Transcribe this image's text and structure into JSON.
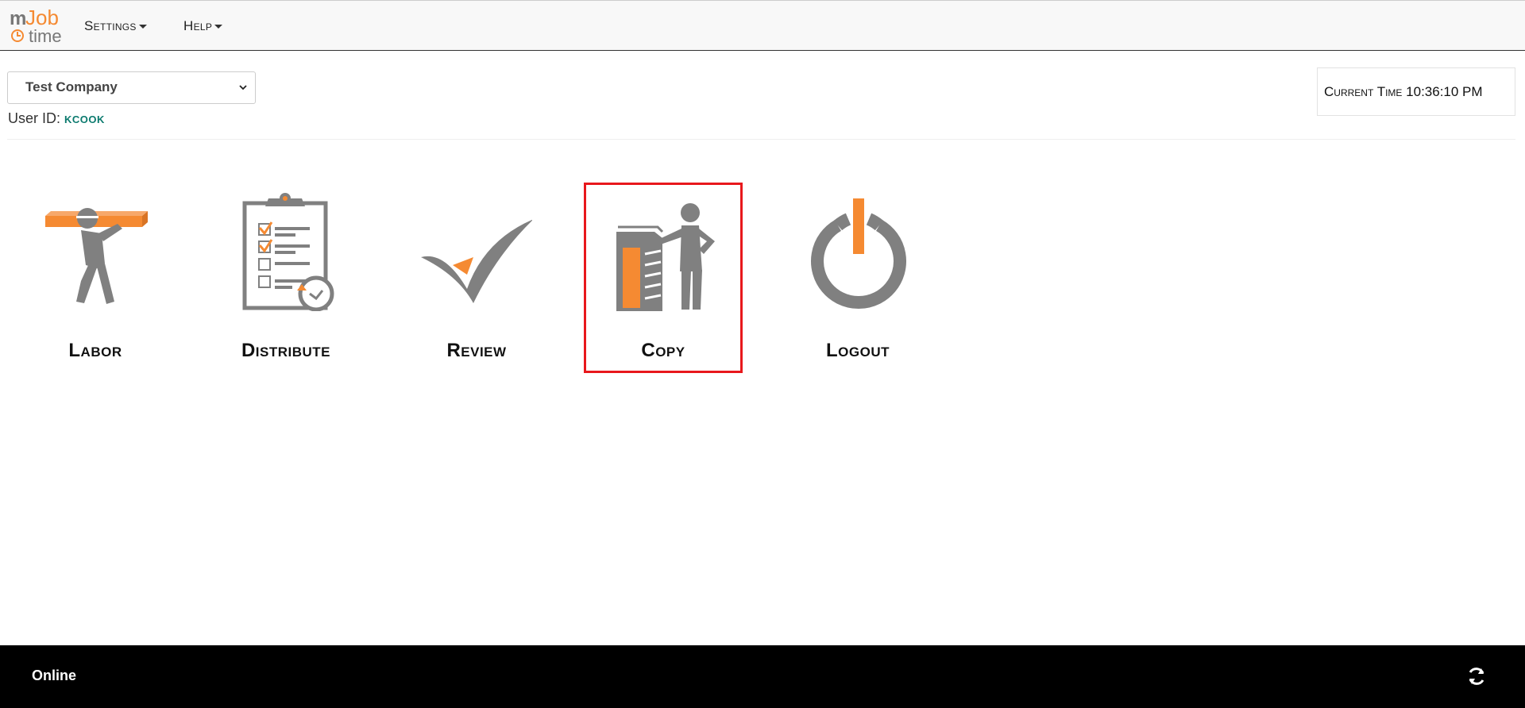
{
  "app": {
    "logo_text_m": "m",
    "logo_text_job": "Job",
    "logo_text_time": "time"
  },
  "nav": {
    "settings_label": "Settings",
    "help_label": "Help"
  },
  "company": {
    "selected": "Test Company"
  },
  "user": {
    "id_label": "User ID:",
    "id_value": "kcook"
  },
  "clock": {
    "label": "Current Time",
    "value": "10:36:10 PM"
  },
  "tiles": [
    {
      "label": "Labor",
      "icon": "worker-carrying-lumber-icon"
    },
    {
      "label": "Distribute",
      "icon": "clipboard-checklist-icon"
    },
    {
      "label": "Review",
      "icon": "checkmark-icon"
    },
    {
      "label": "Copy",
      "icon": "person-copier-icon",
      "selected": true
    },
    {
      "label": "Logout",
      "icon": "power-icon"
    }
  ],
  "footer": {
    "status": "Online",
    "refresh_icon": "refresh-icon"
  },
  "colors": {
    "accent_orange": "#f58a32",
    "icon_gray": "#808080",
    "selection_red": "#e8181c",
    "user_id_teal": "#0b7a6e"
  }
}
